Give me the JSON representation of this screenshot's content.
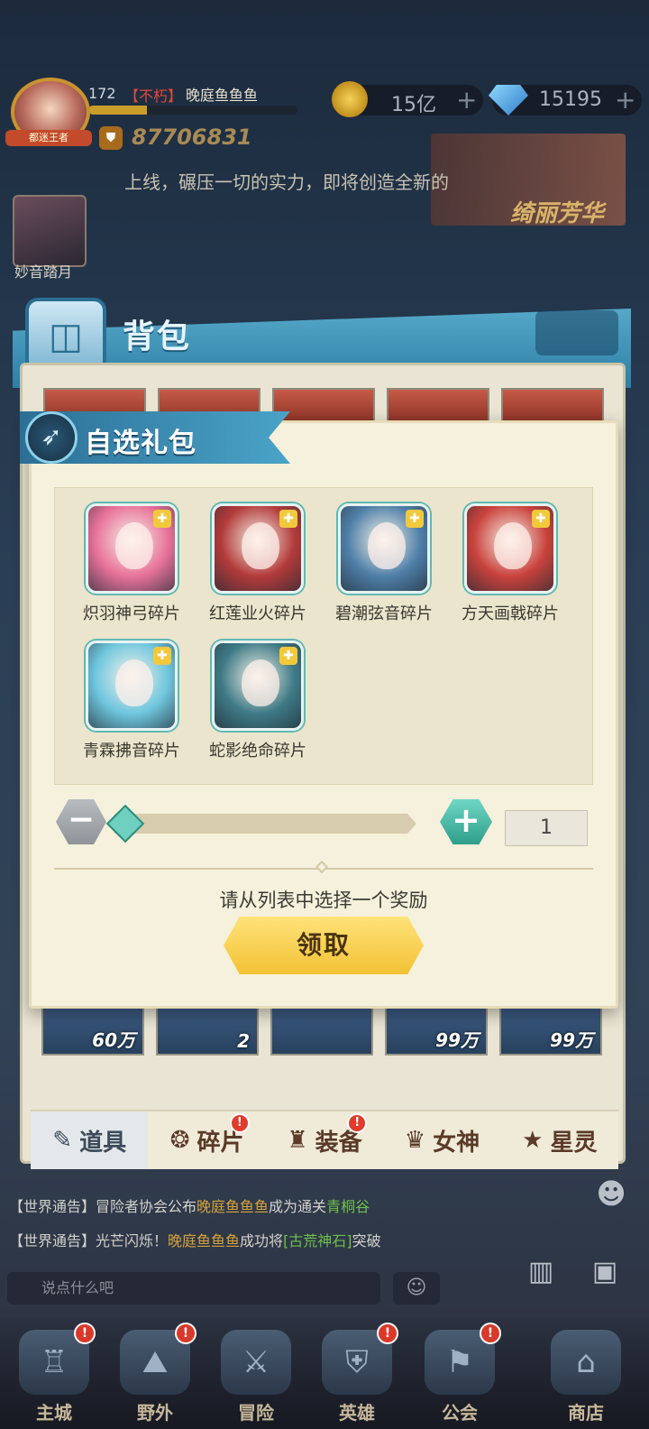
{
  "hud": {
    "level": "172",
    "rank": "【不朽】",
    "player_name": "晚庭鱼鱼鱼",
    "avatar_badge": "都迷王者",
    "power": "87706831",
    "gold": "15亿",
    "gems": "15195",
    "plus": "+",
    "marquee": "上线，碾压一切的实力，即将创造全新的",
    "promo": "绮丽芳华",
    "side_hero_name": "妙音踏月"
  },
  "backpack": {
    "title": "背包",
    "bottom_counts": [
      "60万",
      "2",
      "",
      "99万",
      "99万"
    ],
    "tabs": [
      {
        "label": "道具",
        "icon": "✎",
        "badge": ""
      },
      {
        "label": "碎片",
        "icon": "❂",
        "badge": "!"
      },
      {
        "label": "装备",
        "icon": "♜",
        "badge": "!"
      },
      {
        "label": "女神",
        "icon": "♛",
        "badge": ""
      },
      {
        "label": "星灵",
        "icon": "★",
        "badge": ""
      }
    ]
  },
  "dialog": {
    "title": "自选礼包",
    "items": [
      {
        "label": "炽羽神弓碎片",
        "color": "#e8729a"
      },
      {
        "label": "红莲业火碎片",
        "color": "#b33a3a"
      },
      {
        "label": "碧潮弦音碎片",
        "color": "#4f7fa8"
      },
      {
        "label": "方天画戟碎片",
        "color": "#c9423c"
      },
      {
        "label": "青霖拂音碎片",
        "color": "#6fc6de"
      },
      {
        "label": "蛇影绝命碎片",
        "color": "#3e7a86"
      }
    ],
    "minus": "−",
    "plus": "+",
    "quantity": "1",
    "hint": "请从列表中选择一个奖励",
    "claim": "领取"
  },
  "chat": {
    "line1": {
      "tag": "【世界通告】",
      "text": "冒险者协会公布晚庭鱼鱼鱼成为..."
    },
    "line2": {
      "tag": "【世界通告】",
      "pre": "冒险者协会公布",
      "name": "晚庭鱼鱼鱼",
      "mid": "成为通关",
      "target": "青桐谷"
    },
    "line3": {
      "tag": "【世界通告】",
      "pre": "光芒闪烁！",
      "name": "晚庭鱼鱼鱼",
      "mid": "成功将",
      "target": "[古荒神石]",
      "post": "突破"
    },
    "input_placeholder": "说点什么吧"
  },
  "nav": [
    {
      "label": "主城",
      "icon": "♖",
      "badge": "!"
    },
    {
      "label": "野外",
      "icon": "⛰",
      "badge": "!"
    },
    {
      "label": "冒险",
      "icon": "⚔",
      "badge": ""
    },
    {
      "label": "英雄",
      "icon": "⛨",
      "badge": "!"
    },
    {
      "label": "公会",
      "icon": "⚑",
      "badge": "!"
    },
    {
      "label": "商店",
      "icon": "⌂",
      "badge": ""
    }
  ]
}
